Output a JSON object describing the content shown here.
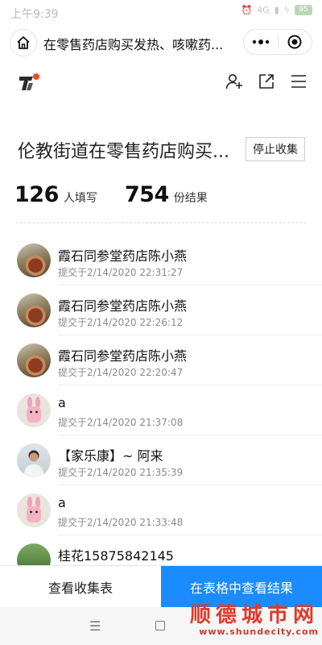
{
  "status_bar": {
    "time": "上午9:39",
    "network": "4G",
    "battery": "95"
  },
  "title_bar": {
    "title": "在零售药店购买发热、咳嗽药...",
    "icons": [
      "home-icon",
      "more-icon",
      "target-icon"
    ]
  },
  "app_header": {
    "icons": [
      "app-logo",
      "add-collaborator-icon",
      "share-external-icon",
      "menu-icon"
    ]
  },
  "form": {
    "title": "伦教街道在零售药店购买...",
    "stop_button": "停止收集"
  },
  "stats": {
    "fill_count": "126",
    "fill_label": "人填写",
    "result_count": "754",
    "result_label": "份结果"
  },
  "submissions": [
    {
      "name": "霞石同参堂药店陈小燕",
      "time": "提交于2/14/2020 22:31:27",
      "avatar": "tea"
    },
    {
      "name": "霞石同参堂药店陈小燕",
      "time": "提交于2/14/2020 22:26:12",
      "avatar": "tea"
    },
    {
      "name": "霞石同参堂药店陈小燕",
      "time": "提交于2/14/2020 22:20:47",
      "avatar": "tea"
    },
    {
      "name": "a",
      "time": "提交于2/14/2020 21:37:08",
      "avatar": "bunny"
    },
    {
      "name": "【家乐康】~ 阿来",
      "time": "提交于2/14/2020 21:35:39",
      "avatar": "man"
    },
    {
      "name": "a",
      "time": "提交于2/14/2020 21:33:48",
      "avatar": "bunny"
    },
    {
      "name": "桂花15875842145",
      "time": "",
      "avatar": "tree"
    }
  ],
  "bottom_bar": {
    "left_label": "查看收集表",
    "right_label": "在表格中查看结果"
  },
  "watermark": {
    "main": "顺德城市网",
    "url": "www.shundecity.com"
  },
  "colors": {
    "primary": "#1a8cff",
    "logo_dot": "#f04a2a",
    "watermark": "#e03a2a"
  }
}
